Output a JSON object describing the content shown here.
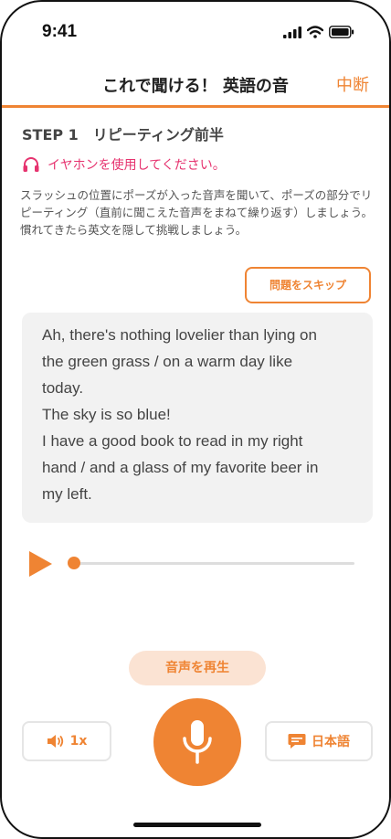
{
  "status_bar": {
    "time": "9:41",
    "icons": [
      "signal-icon",
      "wifi-icon",
      "battery-icon"
    ]
  },
  "header": {
    "title": "これで聞ける！ 英語の音",
    "abort_label": "中断"
  },
  "step_title": "STEP 1　リピーティング前半",
  "notice": {
    "icon": "headphones-icon",
    "text": "イヤホンを使用してください。"
  },
  "instruction": "スラッシュの位置にポーズが入った音声を聞いて、ポーズの部分でリピーティング（直前に聞こえた音声をまねて繰り返す）しましょう。\n慣れてきたら英文を隠して挑戦しましょう。",
  "skip_label": "問題をスキップ",
  "text_lines": [
    "Ah, there's nothing lovelier than lying on",
    "the green grass / on a warm day like",
    "today.",
    "The sky is so blue!",
    "I have a good book to read in my right",
    "hand / and a glass of my favorite beer in",
    "my left."
  ],
  "player": {
    "progress": 0
  },
  "play_audio_label": "音声を再生",
  "speed_label": "1x",
  "language_label": "日本語",
  "colors": {
    "accent": "#ef8433",
    "notice": "#e6336f",
    "text_bg": "#f2f2f2"
  }
}
